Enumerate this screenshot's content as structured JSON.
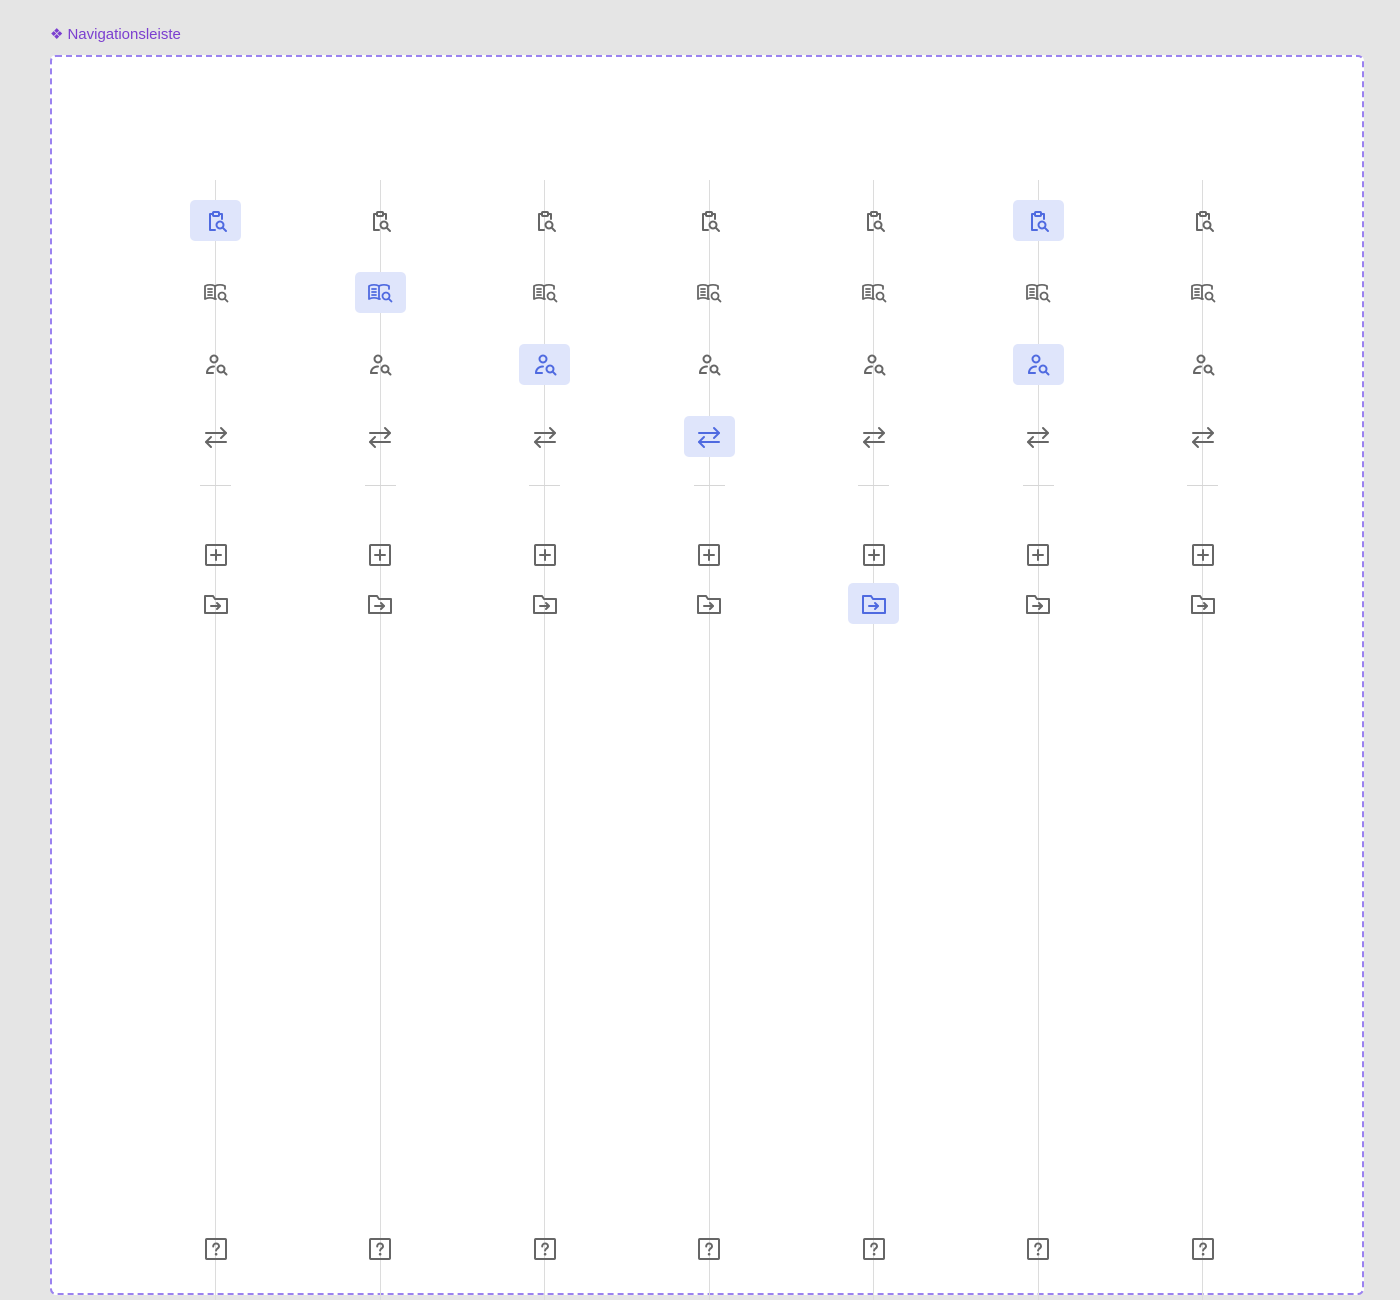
{
  "frame": {
    "label": "Navigationsleiste"
  },
  "colors": {
    "active_bg": "#dfe5fb",
    "active_icon": "#4f6ae0",
    "icon": "#666666",
    "frame_border": "#9b82f0",
    "label": "#7b3fd0"
  },
  "nav_items": [
    {
      "id": "clipboard-search",
      "icon": "clipboard-search-icon"
    },
    {
      "id": "book-search",
      "icon": "book-search-icon"
    },
    {
      "id": "user-search",
      "icon": "user-search-icon"
    },
    {
      "id": "transfer",
      "icon": "arrows-swap-icon"
    },
    {
      "id": "add",
      "icon": "plus-square-icon"
    },
    {
      "id": "folder-move",
      "icon": "folder-arrow-icon"
    },
    {
      "id": "help",
      "icon": "help-square-icon"
    }
  ],
  "variants": [
    {
      "active": [
        "clipboard-search"
      ]
    },
    {
      "active": [
        "book-search"
      ]
    },
    {
      "active": [
        "user-search"
      ]
    },
    {
      "active": [
        "transfer"
      ]
    },
    {
      "active": [
        "folder-move"
      ]
    },
    {
      "active": [
        "clipboard-search",
        "user-search"
      ]
    },
    {
      "active": []
    }
  ]
}
